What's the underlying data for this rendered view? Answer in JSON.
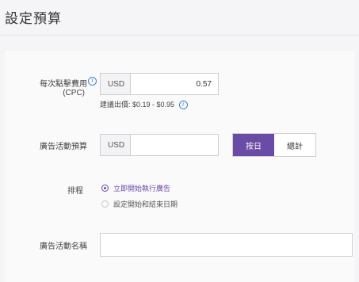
{
  "page_title": "設定預算",
  "cpc": {
    "label_line1": "每次點擊費用",
    "label_line2": "(CPC)",
    "info_icon": "info-icon",
    "currency": "USD",
    "value": "0.57",
    "hint": "建議出價: $0.19 - $0.95"
  },
  "budget": {
    "label": "廣告活動預算",
    "currency": "USD",
    "value": "",
    "period_options": [
      "按日",
      "總計"
    ],
    "selected_period": "按日"
  },
  "schedule": {
    "label": "排程",
    "options": [
      "立即開始執行廣告",
      "設定開始和結束日期"
    ],
    "selected": "立即開始執行廣告"
  },
  "campaign_name": {
    "label": "廣告活動名稱",
    "value": ""
  },
  "colors": {
    "accent": "#6a4ba6",
    "info": "#3a86d9"
  }
}
